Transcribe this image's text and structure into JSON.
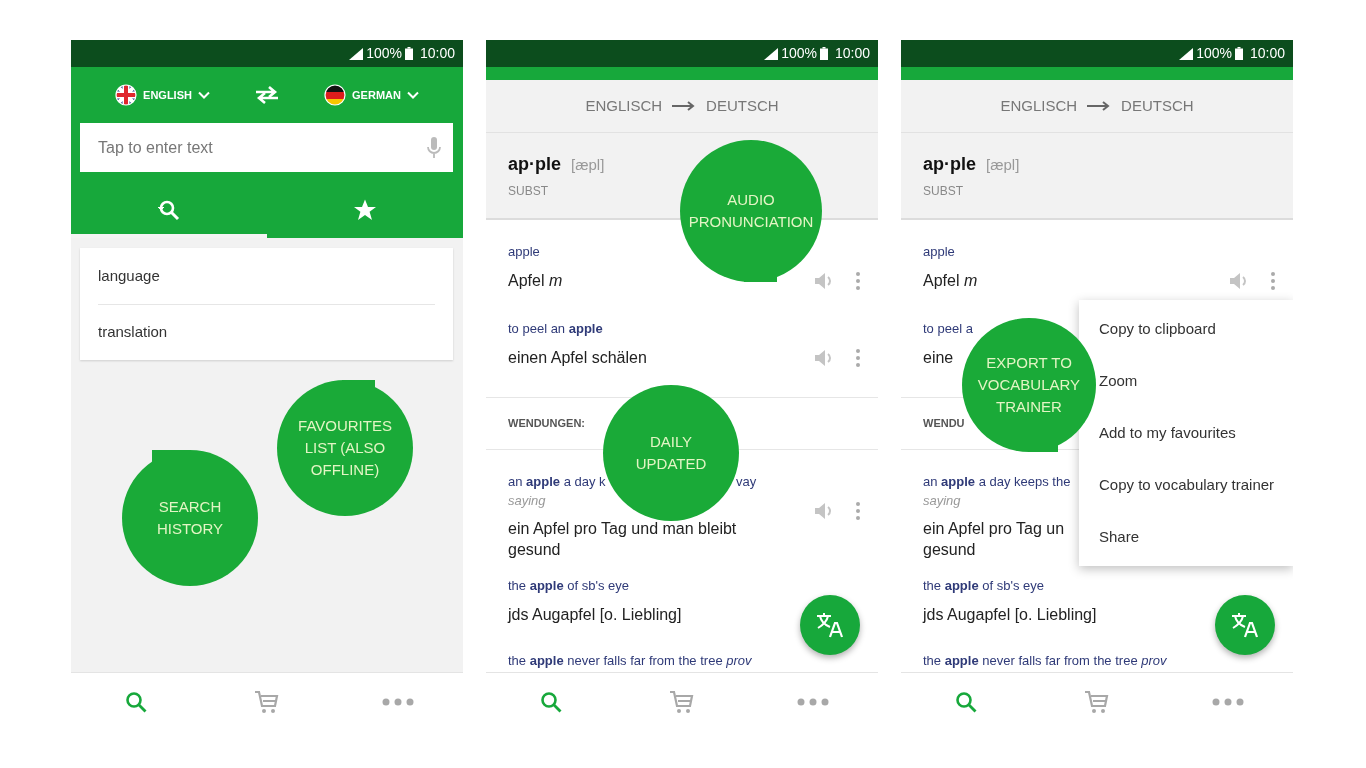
{
  "phones": [
    {
      "kind": "search",
      "status": {
        "battery": "100%",
        "time": "10:00"
      },
      "languages": {
        "source": "ENGLISH",
        "target": "GERMAN"
      },
      "search": {
        "placeholder": "Tap to enter text"
      },
      "tabs": [
        {
          "selected": true
        },
        {
          "selected": false
        }
      ],
      "history": [
        "language",
        "translation"
      ],
      "callouts": [
        "SEARCH HISTORY",
        "FAVOURITES LIST (ALSO OFFLINE)"
      ],
      "bottom_nav": [
        {
          "selected": true
        },
        {
          "selected": false
        },
        {
          "selected": false
        }
      ]
    },
    {
      "kind": "dictionary",
      "status": {
        "battery": "100%",
        "time": "10:00"
      },
      "direction": {
        "from": "ENGLISCH",
        "to": "DEUTSCH"
      },
      "headword": {
        "word": "ap·ple",
        "pronunciation": "[æpl]",
        "part_of_speech": "SUBST"
      },
      "entries": [
        {
          "kind": "sense",
          "source": "apple",
          "target": "Apfel *m*",
          "audio": true
        },
        {
          "kind": "sense",
          "source": "to peel an **apple**",
          "target": "einen Apfel schälen",
          "audio": true
        },
        {
          "kind": "section",
          "label": "WENDUNGEN:"
        },
        {
          "kind": "sense",
          "source": "an **apple** a day k",
          "source_end": "vay",
          "note": "saying",
          "target": "ein Apfel pro Tag und man bleibt gesund",
          "audio": true
        },
        {
          "kind": "sense",
          "source": "the **apple** of sb's eye",
          "target": "jds Augapfel [o. Liebling]",
          "audio": false
        },
        {
          "kind": "sense",
          "source": "the **apple** never falls far from the tree *prov*",
          "audio": false
        }
      ],
      "fab": true,
      "callouts": [
        "AUDIO PRONUNCIATION",
        "DAILY UPDATED"
      ],
      "bottom_nav": [
        {
          "selected": true
        },
        {
          "selected": false
        },
        {
          "selected": false
        }
      ]
    },
    {
      "kind": "dictionary",
      "status": {
        "battery": "100%",
        "time": "10:00"
      },
      "direction": {
        "from": "ENGLISCH",
        "to": "DEUTSCH"
      },
      "headword": {
        "word": "ap·ple",
        "pronunciation": "[æpl]",
        "part_of_speech": "SUBST"
      },
      "entries": [
        {
          "kind": "sense",
          "source": "apple",
          "target": "Apfel *m*",
          "audio": true
        },
        {
          "kind": "sense",
          "source": "to peel a",
          "target": "eine",
          "audio": false
        },
        {
          "kind": "section",
          "label": "WENDU"
        },
        {
          "kind": "sense",
          "source": "an **apple** a day keeps the",
          "note": "saying",
          "target": "ein Apfel pro Tag un",
          "target_end": "gesund",
          "audio": false
        },
        {
          "kind": "sense",
          "source": "the **apple** of sb's eye",
          "target": "jds Augapfel [o. Liebling]",
          "audio": false
        },
        {
          "kind": "sense",
          "source": "the **apple** never falls far from the tree *prov*",
          "audio": false
        }
      ],
      "menu": [
        "Copy to clipboard",
        "Zoom",
        "Add to my favourites",
        "Copy to vocabulary trainer",
        "Share"
      ],
      "fab": true,
      "callouts": [
        "EXPORT TO VOCABULARY TRAINER"
      ],
      "bottom_nav": [
        {
          "selected": true
        },
        {
          "selected": false
        },
        {
          "selected": false
        }
      ]
    }
  ]
}
